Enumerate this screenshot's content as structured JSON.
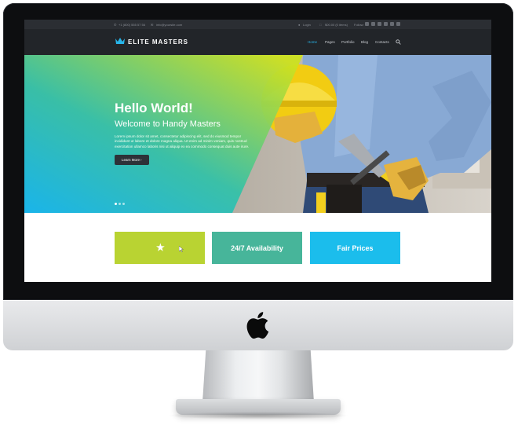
{
  "colors": {
    "accent": "#28b5e9",
    "feature_lime": "#b9d332",
    "feature_teal": "#47b59a",
    "feature_cyan": "#1bbdec",
    "header_bg": "#222529",
    "topbar_bg": "#2b2e33"
  },
  "topbar": {
    "phone": "+1 (800) 555 57 56",
    "email": "info@yoursite.com",
    "login": "Login",
    "cart": "$00.00 (0 items)",
    "follow": "Follow:",
    "social_icons": [
      "facebook-icon",
      "twitter-icon",
      "google-plus-icon",
      "instagram-icon",
      "pinterest-icon",
      "rss-icon"
    ]
  },
  "header": {
    "logo_icon": "crown-icon",
    "logo_text": "ELITE MASTERS",
    "nav": [
      "Home",
      "Pages",
      "Portfolio",
      "Blog",
      "Contacts"
    ],
    "active_nav": "Home",
    "search_icon": "search-icon"
  },
  "hero": {
    "title": "Hello World!",
    "subtitle": "Welcome to Handy Masters",
    "body": "Lorem ipsum dolor sit amet, consectetur adipiscing elit, sed do eiusmod tempor incididunt ut labore et dolore magna aliqua. Ut enim ad minim veniam, quis nostrud exercitation ullamco laboris nisi ut aliquip ex ea commodo consequat duis aute irure.",
    "button": "Learn More",
    "slides": 3,
    "active_slide": 1
  },
  "features": [
    {
      "label": "",
      "icon": "star-icon"
    },
    {
      "label": "24/7 Availability"
    },
    {
      "label": "Fair Prices"
    }
  ]
}
